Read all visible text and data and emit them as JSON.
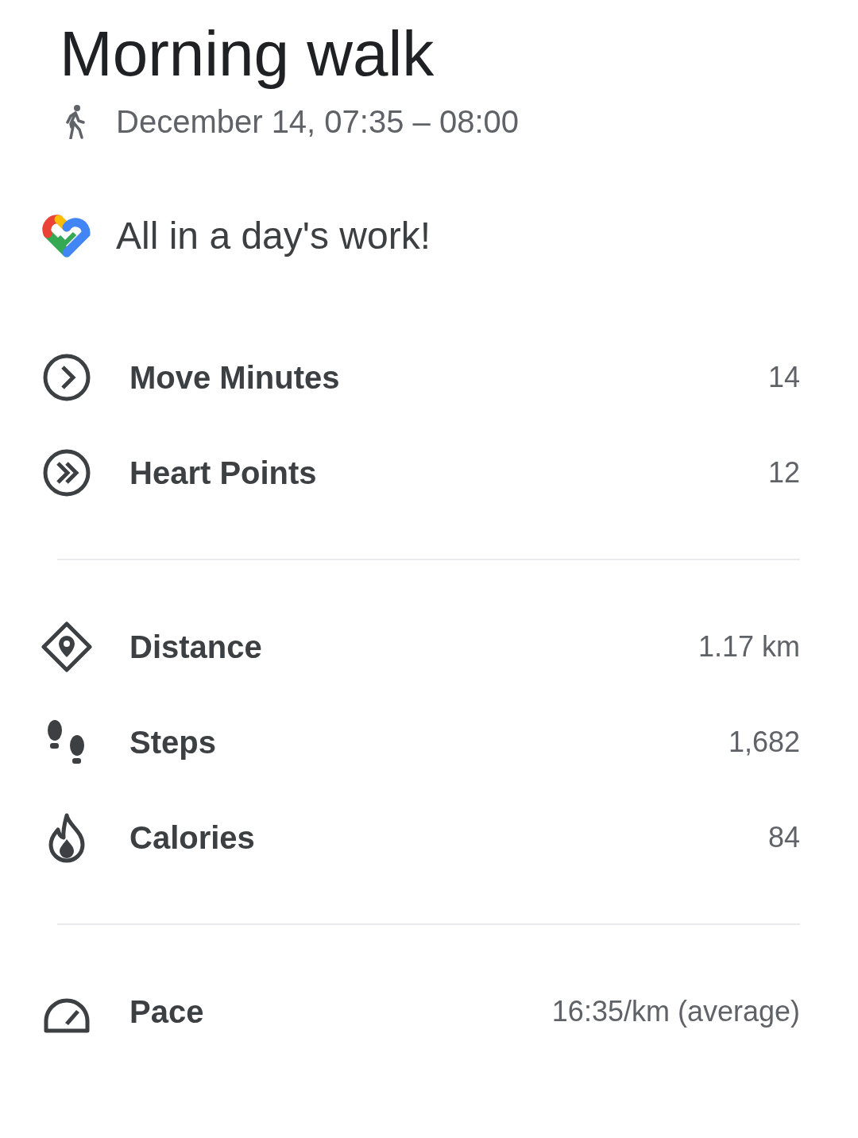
{
  "title": "Morning walk",
  "subtitle": {
    "text": "December 14, 07:35 – 08:00"
  },
  "message": "All in a day's work!",
  "sections": [
    {
      "metrics": [
        {
          "kind": "move",
          "label": "Move Minutes",
          "value": "14"
        },
        {
          "kind": "heart",
          "label": "Heart Points",
          "value": "12"
        }
      ]
    },
    {
      "metrics": [
        {
          "kind": "distance",
          "label": "Distance",
          "value": "1.17 km"
        },
        {
          "kind": "steps",
          "label": "Steps",
          "value": "1,682"
        },
        {
          "kind": "calories",
          "label": "Calories",
          "value": "84"
        }
      ]
    },
    {
      "metrics": [
        {
          "kind": "pace",
          "label": "Pace",
          "value": "16:35/km (average)"
        }
      ]
    }
  ]
}
